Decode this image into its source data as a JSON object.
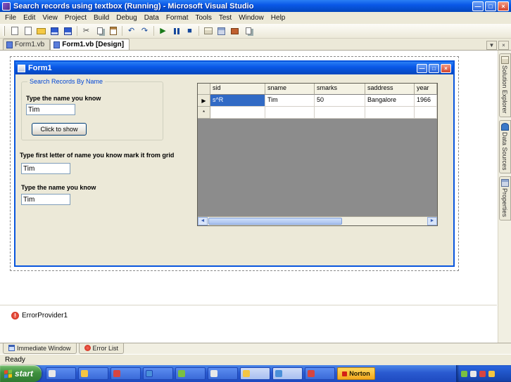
{
  "titlebar": {
    "title": "Search records using textbox (Running) - Microsoft Visual Studio"
  },
  "menu": [
    "File",
    "Edit",
    "View",
    "Project",
    "Build",
    "Debug",
    "Data",
    "Format",
    "Tools",
    "Test",
    "Window",
    "Help"
  ],
  "doc_tabs": {
    "code": "Form1.vb",
    "design": "Form1.vb [Design]"
  },
  "form": {
    "title": "Form1",
    "group": {
      "title": "Search Records By Name",
      "name_label": "Type the name you know",
      "name_value": "Tim",
      "show_button": "Click to show"
    },
    "grid_hint_label": "Type first letter of name you know mark it from grid",
    "grid_hint_value": "Tim",
    "name2_label": "Type the name you know",
    "name2_value": "Tim",
    "grid": {
      "columns": [
        "sid",
        "sname",
        "smarks",
        "saddress",
        "year"
      ],
      "row1": [
        "s^R",
        "Tim",
        "50",
        "Bangalore",
        "1966"
      ],
      "new_row_marker": "*"
    }
  },
  "side_tabs": {
    "solution_explorer": "Solution Explorer",
    "data_sources": "Data Sources",
    "properties": "Properties"
  },
  "tray": {
    "error_provider": "ErrorProvider1"
  },
  "panel_tabs": {
    "immediate": "Immediate Window",
    "error_list": "Error List"
  },
  "statusbar": {
    "text": "Ready"
  },
  "taskbar": {
    "start": "start",
    "norton": "Norton"
  },
  "icons": {
    "minimize": "—",
    "maximize": "□",
    "close": "×",
    "tab_dropdown": "▼",
    "tab_close": "×",
    "row_current": "▶",
    "scroll_left": "◄",
    "scroll_right": "►",
    "error_mark": "!",
    "cut": "✂",
    "undo": "↶",
    "redo": "↷",
    "play": "▶",
    "stop": "■",
    "pause_spacer": ""
  }
}
